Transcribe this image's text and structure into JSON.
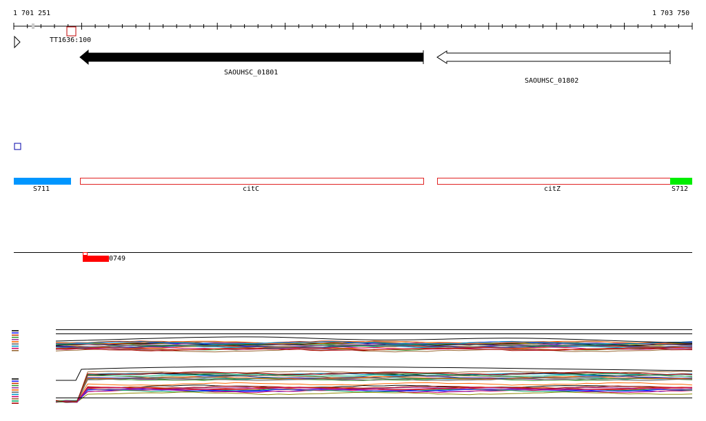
{
  "coords": {
    "start": "1 701 251",
    "end": "1 703 750"
  },
  "tss": {
    "label": "TT1636:100"
  },
  "genes": [
    {
      "label": "SAOUHSC_01801",
      "strand": "minus",
      "fill": "#000000"
    },
    {
      "label": "SAOUHSC_01802",
      "strand": "minus",
      "fill": "#ffffff"
    }
  ],
  "segments": [
    {
      "label": "S711",
      "color": "#0096ff"
    },
    {
      "label": "citC",
      "color": "#e02020"
    },
    {
      "label": "citZ",
      "color": "#e02020"
    },
    {
      "label": "S712",
      "color": "#00ee00"
    }
  ],
  "feature": {
    "label": "0749",
    "color": "#ff0000"
  },
  "colors": {
    "axis": "#000000",
    "tss_box": "#c00000",
    "small_square": "#0000aa"
  },
  "icons": {
    "play_toggle": "triangle-right-icon"
  }
}
